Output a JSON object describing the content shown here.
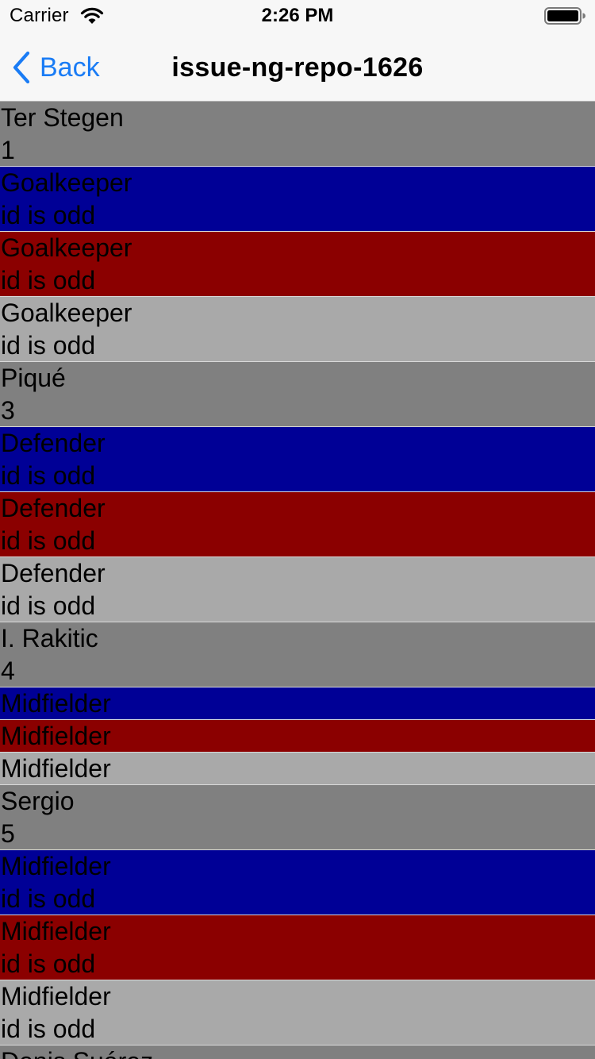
{
  "status_bar": {
    "carrier": "Carrier",
    "time": "2:26 PM",
    "icons": [
      "wifi-icon",
      "battery-icon"
    ]
  },
  "nav_bar": {
    "back_label": "Back",
    "title": "issue-ng-repo-1626",
    "accent_color": "#1a7cf5"
  },
  "colors": {
    "name_row": "#808080",
    "blue_row": "#000096",
    "red_row": "#8b0000",
    "light_row": "#a9a9a9"
  },
  "rows": [
    {
      "style": "gray",
      "lines": [
        "Ter Stegen",
        "1"
      ]
    },
    {
      "style": "blue",
      "lines": [
        "Goalkeeper",
        "id is odd"
      ]
    },
    {
      "style": "red",
      "lines": [
        "Goalkeeper",
        "id is odd"
      ]
    },
    {
      "style": "light",
      "lines": [
        "Goalkeeper",
        "id is odd"
      ]
    },
    {
      "style": "gray",
      "lines": [
        "Piqué",
        "3"
      ]
    },
    {
      "style": "blue",
      "lines": [
        "Defender",
        "id is odd"
      ]
    },
    {
      "style": "red",
      "lines": [
        "Defender",
        "id is odd"
      ]
    },
    {
      "style": "light",
      "lines": [
        "Defender",
        "id is odd"
      ]
    },
    {
      "style": "gray",
      "lines": [
        "I. Rakitic",
        "4"
      ]
    },
    {
      "style": "blue",
      "lines": [
        "Midfielder"
      ]
    },
    {
      "style": "red",
      "lines": [
        "Midfielder"
      ]
    },
    {
      "style": "light",
      "lines": [
        "Midfielder"
      ]
    },
    {
      "style": "gray",
      "lines": [
        "Sergio",
        "5"
      ]
    },
    {
      "style": "blue",
      "lines": [
        "Midfielder",
        "id is odd"
      ]
    },
    {
      "style": "red",
      "lines": [
        "Midfielder",
        "id is odd"
      ]
    },
    {
      "style": "light",
      "lines": [
        "Midfielder",
        "id is odd"
      ]
    },
    {
      "style": "gray",
      "lines": [
        "Denis Suárez"
      ]
    }
  ]
}
